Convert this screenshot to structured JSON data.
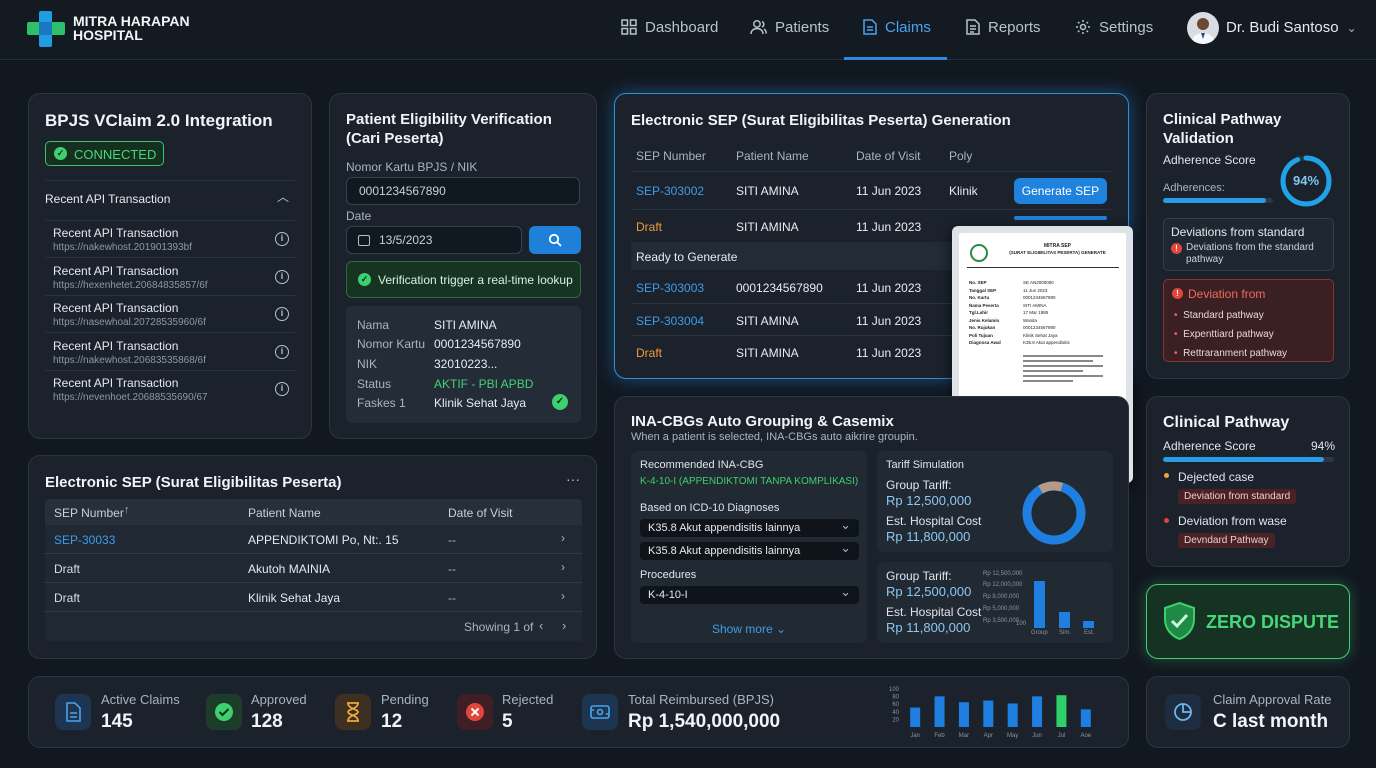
{
  "brand": {
    "line1": "MITRA HARAPAN",
    "line2": "HOSPITAL"
  },
  "nav": {
    "items": [
      {
        "label": "Dashboard",
        "icon": "grid-icon"
      },
      {
        "label": "Patients",
        "icon": "users-icon"
      },
      {
        "label": "Claims",
        "icon": "document-icon",
        "active": true
      },
      {
        "label": "Reports",
        "icon": "report-icon"
      },
      {
        "label": "Settings",
        "icon": "gear-icon"
      }
    ],
    "user": "Dr. Budi Santoso"
  },
  "vclaim": {
    "title": "BPJS VClaim 2.0 Integration",
    "status": "CONNECTED",
    "recent_header": "Recent API Transaction",
    "rows": [
      {
        "title": "Recent API Transaction",
        "url": "https://nakewhost.201901393bf"
      },
      {
        "title": "Recent API Transaction",
        "url": "https://hexenhetet.20684835857/6f"
      },
      {
        "title": "Recent API Transaction",
        "url": "https://nasewhoal.20728535960/6f"
      },
      {
        "title": "Recent API Transaction",
        "url": "https://nakewhost.20683535868/6f"
      },
      {
        "title": "Recent API Transaction",
        "url": "https://nevenhoet.20688535690/67"
      }
    ]
  },
  "eligibility": {
    "title_l1": "Patient Eligibility Verification",
    "title_l2": "(Cari Peserta)",
    "card_label": "Nomor Kartu BPJS / NIK",
    "card_value": "0001234567890",
    "date_label": "Date",
    "date_value": "13/5/2023",
    "notice": "Verification trigger a real-time lookup",
    "fields": [
      {
        "label": "Nama",
        "value": "SITI AMINA"
      },
      {
        "label": "Nomor Kartu",
        "value": "0001234567890"
      },
      {
        "label": "NIK",
        "value": "32010223..."
      },
      {
        "label": "Status",
        "value": "AKTIF - PBI APBD"
      },
      {
        "label": "Faskes 1",
        "value": "Klinik Sehat Jaya"
      }
    ]
  },
  "sep_gen": {
    "title": "Electronic SEP (Surat Eligibilitas Peserta) Generation",
    "headers": [
      "SEP Number",
      "Patient Name",
      "Date of Visit",
      "Poly"
    ],
    "rows": [
      {
        "sep": "SEP-303002",
        "name": "SITI AMINA",
        "date": "11 Jun 2023",
        "poly": "Klinik",
        "action": "Generate SEP"
      },
      {
        "sep": "Draft",
        "name": "SITI AMINA",
        "date": "11 Jun 2023"
      },
      {
        "section": "Ready to Generate"
      },
      {
        "sep": "SEP-303003",
        "name": "0001234567890",
        "date": "11 Jun 2023"
      },
      {
        "sep": "SEP-303004",
        "name": "SITI AMINA",
        "date": "11 Jun 2023"
      },
      {
        "sep": "Draft",
        "name": "SITI AMINA",
        "date": "11 Jun 2023"
      }
    ],
    "doc": {
      "heading1": "MITRA SEP",
      "heading2": "(SURAT ELIGIBILITAS PESERTA) GENERATE",
      "fields": [
        {
          "label": "No. SEP",
          "value": "SE AN2000000"
        },
        {
          "label": "Tanggal SEP",
          "value": "11 Jun 2023"
        },
        {
          "label": "No. Kartu",
          "value": "0001234567890"
        },
        {
          "label": "Nama Peserta",
          "value": "SITI AMINA"
        },
        {
          "label": "Tgl.Lahir",
          "value": "17 Mar 1985"
        },
        {
          "label": "Jenis Kelamin",
          "value": "Wanita"
        },
        {
          "label": "No. Rujukan",
          "value": "0001234567890"
        },
        {
          "label": "Poli Tujuan",
          "value": "Klinik Sehat Jaya"
        },
        {
          "label": "Diagnosa Awal",
          "value": "K35.8 Akut appendisitis"
        }
      ],
      "signature": "Digital Signature",
      "sig_name": "Digital Rencana",
      "sig_num": "Dr. No. 000000000"
    }
  },
  "pathway1": {
    "title_l1": "Clinical Pathway",
    "title_l2": "Validation",
    "adherence_label": "Adherence Score",
    "adherences_label": "Adherences:",
    "score": "94%",
    "score_value": 0.94,
    "dev_title": "Deviations from standard",
    "dev_sub": "Deviations from the standard pathway",
    "dev2_title": "Deviation from",
    "dev2_items": [
      "Standard pathway",
      "Expenttiard pathway",
      "Rettraranment pathway"
    ]
  },
  "sep_table": {
    "title": "Electronic SEP (Surat Eligibilitas Peserta)",
    "menu": "···",
    "headers": [
      "SEP Number",
      "Patient Name",
      "Date of Visit"
    ],
    "rows": [
      {
        "sep": "SEP-30033",
        "name": "APPENDIKTOMI  Po, Nt:. 15",
        "date": "--"
      },
      {
        "sep": "Draft",
        "name": "Akutoh MAINIA",
        "date": "--"
      },
      {
        "sep": "Draft",
        "name": "Klinik Sehat Jaya",
        "date": "--"
      }
    ],
    "pager": "Showing 1 of"
  },
  "inacbg": {
    "title": "INA-CBGs Auto Grouping & Casemix",
    "subtitle": "When a patient is selected, INA-CBGs auto aikrire groupin.",
    "rec_label": "Recommended INA-CBG",
    "rec_value": "K-4-10-I (APPENDIKTOMI TANPA KOMPLIKASI)",
    "icd_label": "Based on ICD-10 Diagnoses",
    "icd": [
      "K35.8 Akut appendisitis lainnya",
      "K35.8 Akut appendisitis lainnya"
    ],
    "proc_label": "Procedures",
    "proc": "K-4-10-I",
    "show_more": "Show more",
    "sim_title": "Tariff Simulation",
    "group_label": "Group Tariff:",
    "group_value": "Rp 12,500,000",
    "est_label": "Est. Hospital Cost",
    "est_value": "Rp 11,800,000",
    "sim2_group_label": "Group Tariff:",
    "sim2_group_value": "Rp 12,500,000",
    "sim2_est_label": "Est. Hospital Cost",
    "sim2_est_value": "Rp 11,800,000",
    "mini_ticks": [
      "Rp 12,500,000",
      "Rp 12,000,000",
      "Rp 8,000,000",
      "Rp 5,000,000",
      "Rp 3,500,000",
      "100"
    ],
    "mini_cats": [
      "Group",
      "Sim.",
      "Est."
    ],
    "mini_values": [
      100,
      35,
      15
    ]
  },
  "pathway2": {
    "title": "Clinical Pathway",
    "adherence_label": "Adherence Score",
    "score": "94%",
    "score_value": 0.94,
    "items": [
      {
        "label": "Dejected case",
        "tag": "Deviation from standard"
      },
      {
        "label": "Deviation from wase",
        "tag": "Devndard Pathway"
      }
    ]
  },
  "zero": {
    "label": "ZERO DISPUTE"
  },
  "stats": [
    {
      "label": "Active Claims",
      "value": "145",
      "icon": "document-icon"
    },
    {
      "label": "Approved",
      "value": "128",
      "icon": "check-icon"
    },
    {
      "label": "Pending",
      "value": "12",
      "icon": "hourglass-icon"
    },
    {
      "label": "Rejected",
      "value": "5",
      "icon": "x-icon"
    },
    {
      "label": "Total Reimbursed (BPJS)",
      "value": "Rp 1,540,000,000",
      "icon": "money-icon"
    }
  ],
  "chart_data": {
    "type": "bar",
    "categories": [
      "Jan",
      "Feb",
      "Mar",
      "Apr",
      "May",
      "Jun",
      "Jul",
      "Aoe"
    ],
    "values": [
      33,
      52,
      42,
      45,
      40,
      52,
      54,
      30
    ],
    "ylim": [
      0,
      100
    ],
    "yticks": [
      "100",
      "80",
      "60",
      "40",
      "20"
    ],
    "colors": {
      "default": "#1e7fe0",
      "highlight": "#2fd06a"
    },
    "highlight_index": 6
  },
  "approval": {
    "label": "Claim Approval Rate",
    "value": "C last month"
  }
}
